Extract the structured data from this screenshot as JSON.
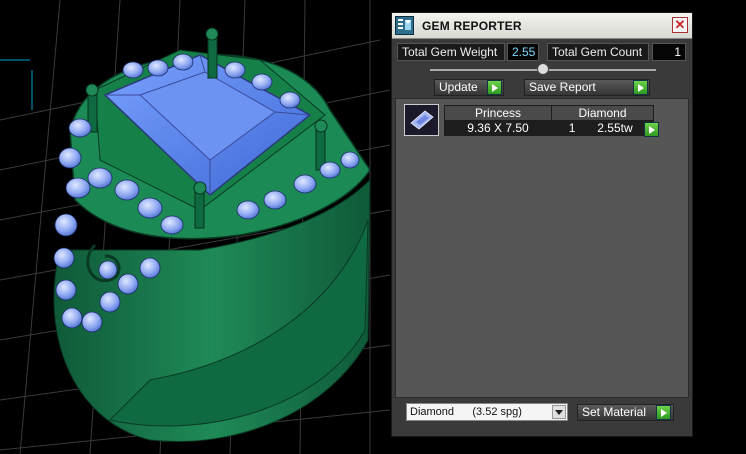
{
  "window": {
    "title": "GEM REPORTER"
  },
  "totals": {
    "weight_label": "Total Gem Weight",
    "weight_value": "2.55",
    "count_label": "Total Gem Count",
    "count_value": "1"
  },
  "actions": {
    "update_label": "Update",
    "save_report_label": "Save Report"
  },
  "gem_list": [
    {
      "cut": "Princess",
      "material": "Diamond",
      "size": "9.36 X 7.50",
      "count": "1",
      "weight": "2.55tw"
    }
  ],
  "material": {
    "selected": "Diamond      (3.52 spg)",
    "set_label": "Set Material"
  },
  "colors": {
    "ring_green": "#1f8a57",
    "gem_blue": "#5b8ce8",
    "accent_cyan": "#7fd8ff",
    "go_green": "#3aae2a"
  },
  "icons": {
    "app": "gem-reporter-app-icon",
    "close": "close-icon",
    "go": "play-arrow-icon",
    "thumbnail": "princess-gem-icon"
  }
}
